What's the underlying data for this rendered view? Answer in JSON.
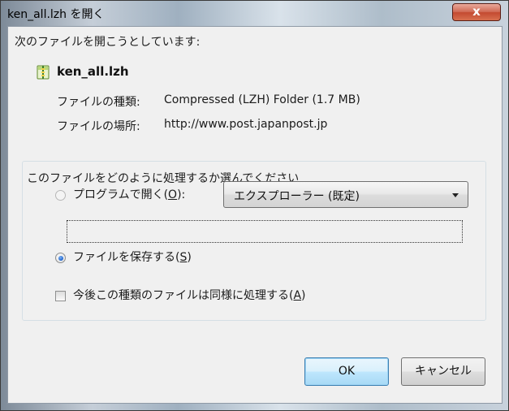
{
  "window": {
    "title": "ken_all.lzh を開く",
    "close_label": "x"
  },
  "intro": "次のファイルを開こうとしています:",
  "file": {
    "name": "ken_all.lzh",
    "icon": "compressed-folder-icon",
    "type_label": "ファイルの種類:",
    "type_value": "Compressed (LZH) Folder (1.7 MB)",
    "location_label": "ファイルの場所:",
    "location_value": "http://www.post.japanpost.jp"
  },
  "group": {
    "legend": "このファイルをどのように処理するか選んでください",
    "open_with": {
      "label_prefix": "プログラムで開く(",
      "accel": "O",
      "label_suffix": "):",
      "checked": false,
      "program": "エクスプローラー (既定)"
    },
    "save": {
      "label_prefix": "ファイルを保存する(",
      "accel": "S",
      "label_suffix": ")",
      "checked": true
    },
    "remember": {
      "label_prefix": "今後この種類のファイルは同様に処理する(",
      "accel": "A",
      "label_suffix": ")",
      "checked": false
    }
  },
  "buttons": {
    "ok": "OK",
    "cancel": "キャンセル"
  }
}
